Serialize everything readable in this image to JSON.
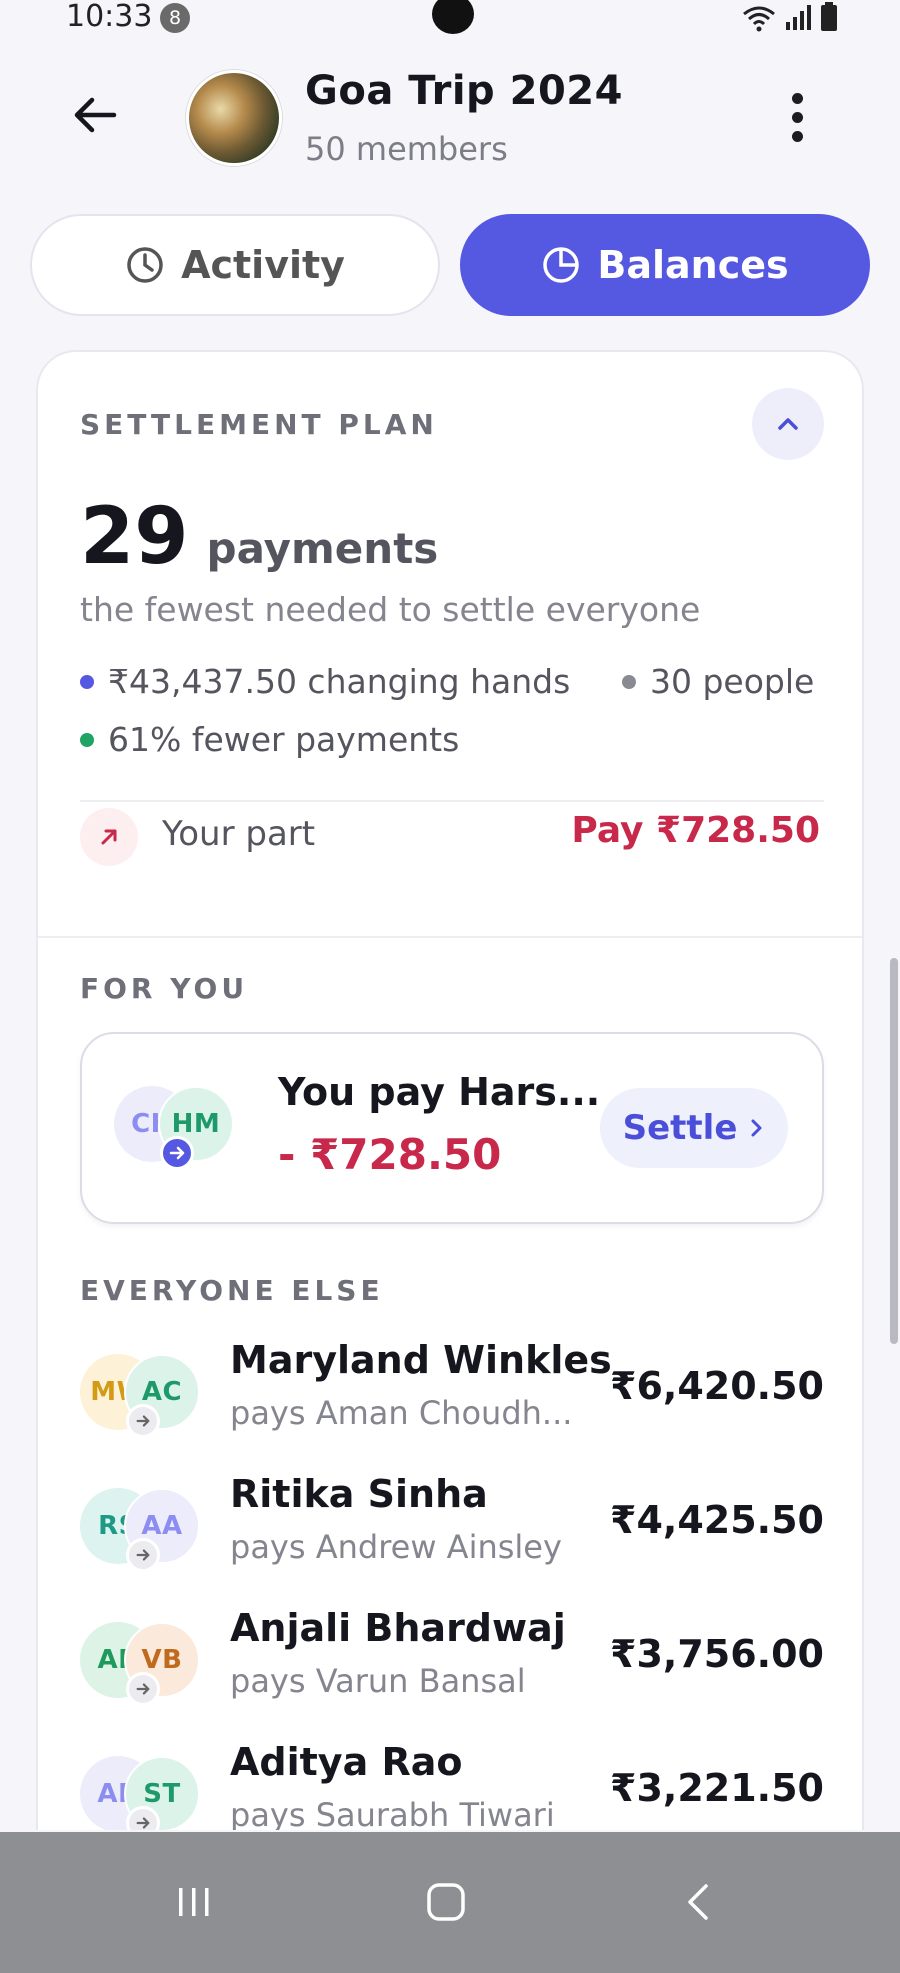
{
  "status_bar": {
    "time": "10:33",
    "notification_count": "8",
    "icons": [
      "wifi-icon",
      "signal-icon",
      "battery-icon"
    ]
  },
  "header": {
    "title": "Goa Trip 2024",
    "subtitle": "50 members",
    "back_icon": "arrow-left-icon",
    "more_icon": "more-vertical-icon"
  },
  "tabs": [
    {
      "label": "Activity",
      "icon": "clock-icon",
      "selected": false
    },
    {
      "label": "Balances",
      "icon": "pie-chart-icon",
      "selected": true
    }
  ],
  "settlement": {
    "section_label": "SETTLEMENT PLAN",
    "count": "29",
    "count_unit": "payments",
    "description": "the fewest needed to settle everyone",
    "stats": [
      {
        "text": "₹43,437.50 changing hands",
        "color": "#5558e0"
      },
      {
        "text": "30 people",
        "color": "#8a8a92"
      },
      {
        "text": "61% fewer payments",
        "color": "#1fa463"
      }
    ],
    "your_part": {
      "label": "Your part",
      "amount": "Pay ₹728.50"
    }
  },
  "for_you": {
    "section_label": "FOR YOU",
    "from_initials": "CH",
    "to_initials": "HM",
    "title": "You pay Hars...",
    "amount": "- ₹728.50",
    "settle_label": "Settle"
  },
  "everyone_else": {
    "section_label": "EVERYONE ELSE",
    "rows": [
      {
        "from": "MW",
        "to": "AC",
        "name": "Maryland Winkles",
        "sub": "pays Aman Choudh...",
        "amount": "₹6,420.50"
      },
      {
        "from": "RS",
        "to": "AA",
        "name": "Ritika Sinha",
        "sub": "pays Andrew Ainsley",
        "amount": "₹4,425.50"
      },
      {
        "from": "AB",
        "to": "VB",
        "name": "Anjali Bhardwaj",
        "sub": "pays Varun Bansal",
        "amount": "₹3,756.00"
      },
      {
        "from": "AR",
        "to": "ST",
        "name": "Aditya Rao",
        "sub": "pays Saurabh Tiwari",
        "amount": "₹3,221.50"
      }
    ]
  },
  "colors": {
    "accent": "#5558e0",
    "negative": "#c8284a",
    "positive": "#1fa463"
  }
}
